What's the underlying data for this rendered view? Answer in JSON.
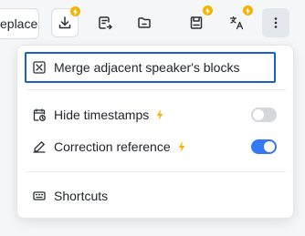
{
  "toolbar": {
    "replace_label": "eplace",
    "buttons": [
      {
        "name": "download",
        "icon": "download-icon",
        "premium": true
      },
      {
        "name": "export",
        "icon": "export-icon",
        "premium": false
      },
      {
        "name": "folder",
        "icon": "folder-icon",
        "premium": false
      },
      {
        "name": "save",
        "icon": "save-icon",
        "premium": true
      },
      {
        "name": "translate",
        "icon": "translate-icon",
        "premium": true
      },
      {
        "name": "more",
        "icon": "more-vertical-icon",
        "premium": false
      }
    ],
    "badge_color": "#f5b301"
  },
  "menu": {
    "merge": {
      "label": "Merge adjacent speaker's blocks",
      "icon": "merge-icon",
      "highlight_color": "#1a5fd0"
    },
    "hide_timestamps": {
      "label": "Hide timestamps",
      "icon": "calendar-clock-icon",
      "premium": true,
      "enabled": false
    },
    "correction_reference": {
      "label": "Correction reference",
      "icon": "pen-icon",
      "premium": true,
      "enabled": true
    },
    "shortcuts": {
      "label": "Shortcuts",
      "icon": "keyboard-icon"
    },
    "toggle_on_color": "#3478f6",
    "premium_color": "#f5b301"
  }
}
